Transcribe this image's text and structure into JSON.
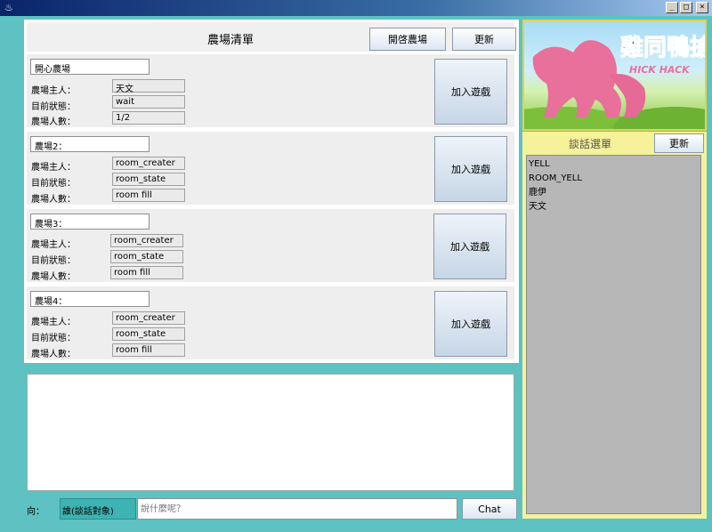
{
  "window": {
    "title": ""
  },
  "farm_list": {
    "title": "農場清單",
    "open_label": "開啓農場",
    "refresh_label": "更新"
  },
  "labels": {
    "owner": "農場主人：",
    "state": "目前狀態：",
    "count": "農場人數：",
    "join": "加入遊戲"
  },
  "rooms": [
    {
      "name": "開心農場",
      "owner": "天文",
      "state": "wait",
      "count": "1/2"
    },
    {
      "name": "農場2：",
      "owner": "room_creater",
      "state": "room_state",
      "count": "room fill"
    },
    {
      "name": "農場3：",
      "owner": "room_creater",
      "state": "room_state",
      "count": "room fill"
    },
    {
      "name": "農場4：",
      "owner": "room_creater",
      "state": "room_state",
      "count": "room fill"
    }
  ],
  "chat": {
    "to_label": "向：",
    "target": "誰(談話對象)",
    "placeholder": "說什麼呢？",
    "send_label": "Chat"
  },
  "chat_list": {
    "title": "談話選單",
    "refresh_label": "更新",
    "users": [
      "YELL",
      "ROOM_YELL",
      "鹿伊",
      "天文"
    ]
  },
  "logo": {
    "text": "雞同鴨搶",
    "subtext": "HICK HACK"
  },
  "colors": {
    "background": "#5ec2c2",
    "chat_panel": "#f6f29a",
    "logo_pink": "#e8709a"
  }
}
